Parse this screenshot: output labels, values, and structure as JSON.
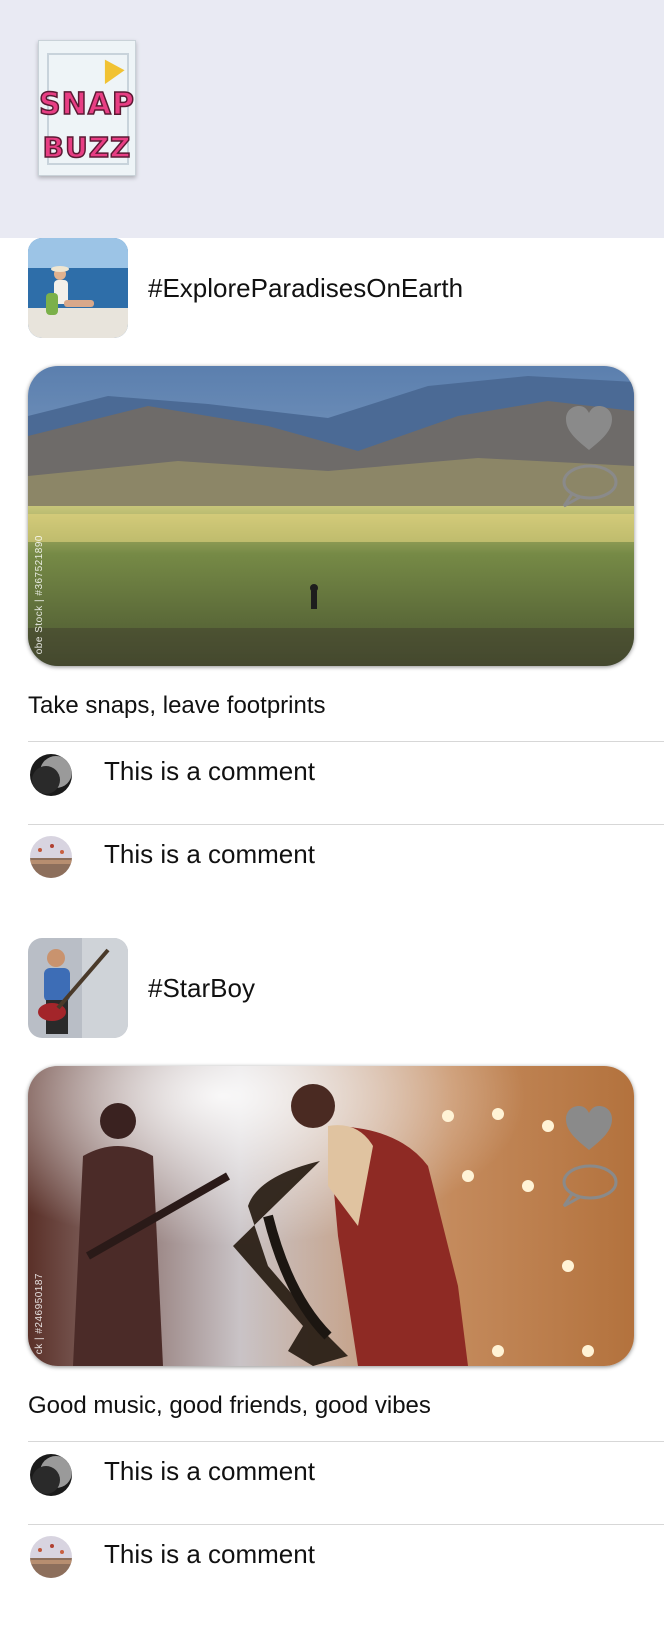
{
  "app": {
    "logo_line1": "SNAP",
    "logo_line2": "BUZZ",
    "header_bg": "#e9eaf3"
  },
  "posts": [
    {
      "hashtag": "#ExploreParadisesOnEarth",
      "avatar_icon": "traveler-photo",
      "photo_credit": "obe Stock | #367521890",
      "caption": "Take snaps, leave footprints",
      "comments": [
        {
          "text": "This is a comment",
          "avatar_icon": "moon-photo"
        },
        {
          "text": "This is a comment",
          "avatar_icon": "hot-air-balloons-photo"
        }
      ]
    },
    {
      "hashtag": "#StarBoy",
      "avatar_icon": "boy-guitar-photo",
      "photo_credit": "ck | #246950187",
      "caption": "Good music, good friends, good vibes",
      "comments": [
        {
          "text": "This is a comment",
          "avatar_icon": "moon-photo"
        },
        {
          "text": "This is a comment",
          "avatar_icon": "hot-air-balloons-photo"
        }
      ]
    }
  ],
  "icons": {
    "like": "heart-icon",
    "comment": "speech-bubble-icon"
  },
  "colors": {
    "icon_gray": "#8a8a8a",
    "divider": "#d7d7d7"
  }
}
